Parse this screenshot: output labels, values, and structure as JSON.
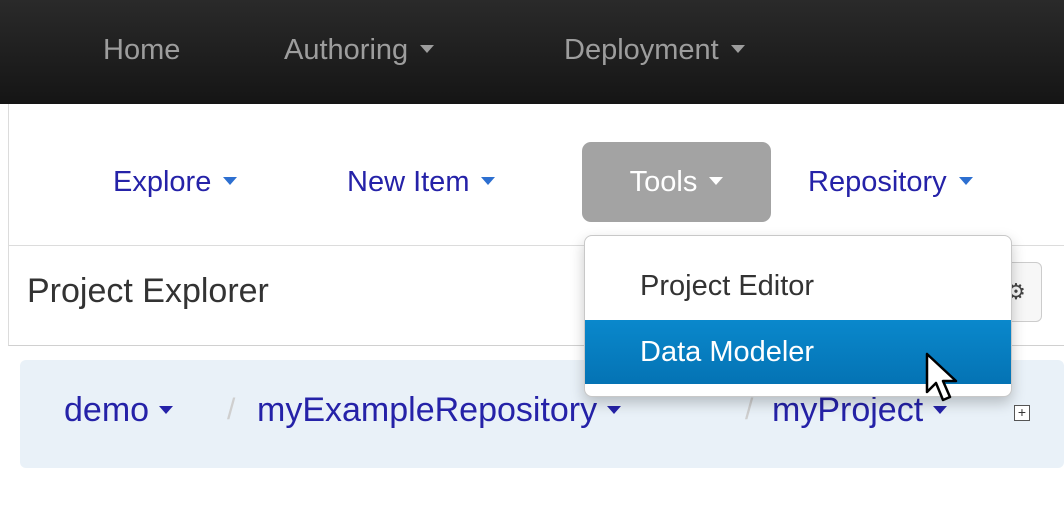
{
  "topnav": {
    "home": "Home",
    "authoring": "Authoring",
    "deployment": "Deployment"
  },
  "subnav": {
    "explore": "Explore",
    "new_item": "New Item",
    "tools": "Tools",
    "repository": "Repository"
  },
  "tools_menu": {
    "items": [
      "Project Editor",
      "Data Modeler"
    ],
    "highlighted": "Data Modeler"
  },
  "panel": {
    "title": "Project Explorer",
    "settings_icon": "gear-icon"
  },
  "breadcrumb": {
    "items": [
      "demo",
      "myExampleRepository",
      "myProject"
    ],
    "separator": "/",
    "expand_icon": "plus-box-icon"
  },
  "colors": {
    "navbar": "#1f1f1f",
    "link": "#2522a8",
    "tools_active": "#a3a3a3",
    "menu_highlight": "#0a80c2",
    "breadcrumb_bg": "#e9f1f8"
  }
}
